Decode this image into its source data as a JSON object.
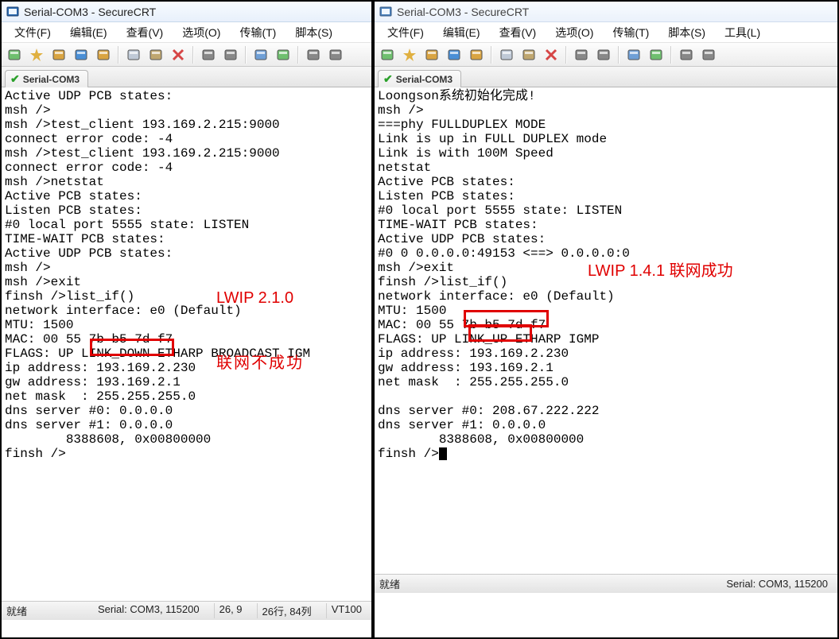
{
  "left": {
    "title": "Serial-COM3 - SecureCRT",
    "menus": {
      "file": "文件(F)",
      "edit": "编辑(E)",
      "view": "查看(V)",
      "options": "选项(O)",
      "transfer": "传输(T)",
      "script": "脚本(S)"
    },
    "tab": "Serial-COM3",
    "terminal_lines": [
      "Active UDP PCB states:",
      "msh />",
      "msh />test_client 193.169.2.215:9000",
      "connect error code: -4",
      "msh />test_client 193.169.2.215:9000",
      "connect error code: -4",
      "msh />netstat",
      "Active PCB states:",
      "Listen PCB states:",
      "#0 local port 5555 state: LISTEN",
      "TIME-WAIT PCB states:",
      "Active UDP PCB states:",
      "msh />",
      "msh />exit",
      "finsh />list_if()",
      "network interface: e0 (Default)",
      "MTU: 1500",
      "MAC: 00 55 7b b5 7d f7",
      "FLAGS: UP LINK_DOWN ETHARP BROADCAST IGM",
      "ip address: 193.169.2.230",
      "gw address: 193.169.2.1",
      "net mask  : 255.255.255.0",
      "dns server #0: 0.0.0.0",
      "dns server #1: 0.0.0.0",
      "        8388608, 0x00800000",
      "finsh />"
    ],
    "annotation_top": "LWIP 2.1.0",
    "annotation_bottom": "联网不成功",
    "status": {
      "ready": "就绪",
      "serial": "Serial: COM3, 115200",
      "cursor": "26,  9",
      "size": "26行, 84列",
      "emu": "VT100"
    }
  },
  "right": {
    "title": "Serial-COM3 - SecureCRT",
    "menus": {
      "file": "文件(F)",
      "edit": "编辑(E)",
      "view": "查看(V)",
      "options": "选项(O)",
      "transfer": "传输(T)",
      "script": "脚本(S)",
      "tools": "工具(L)"
    },
    "tab": "Serial-COM3",
    "terminal_lines": [
      "Loongson系统初始化完成!",
      "msh />",
      "===phy FULLDUPLEX MODE",
      "Link is up in FULL DUPLEX mode",
      "Link is with 100M Speed",
      "netstat",
      "Active PCB states:",
      "Listen PCB states:",
      "#0 local port 5555 state: LISTEN",
      "TIME-WAIT PCB states:",
      "Active UDP PCB states:",
      "#0 0 0.0.0.0:49153 <==> 0.0.0.0:0",
      "msh />exit",
      "finsh />list_if()",
      "network interface: e0 (Default)",
      "MTU: 1500",
      "MAC: 00 55 7b b5 7d f7",
      "FLAGS: UP LINK_UP ETHARP IGMP",
      "ip address: 193.169.2.230",
      "gw address: 193.169.2.1",
      "net mask  : 255.255.255.0",
      "",
      "dns server #0: 208.67.222.222",
      "dns server #1: 0.0.0.0",
      "        8388608, 0x00800000",
      "finsh />"
    ],
    "annotation": "LWIP 1.4.1 联网成功",
    "status": {
      "ready": "就绪",
      "serial": "Serial: COM3, 115200"
    }
  },
  "icons": {
    "new": "new",
    "quick": "quick",
    "open": "open",
    "save": "save",
    "reconnect": "reconnect",
    "copy": "copy",
    "paste": "paste",
    "stop": "stop",
    "props": "props",
    "print": "print",
    "find": "find",
    "send": "send"
  }
}
